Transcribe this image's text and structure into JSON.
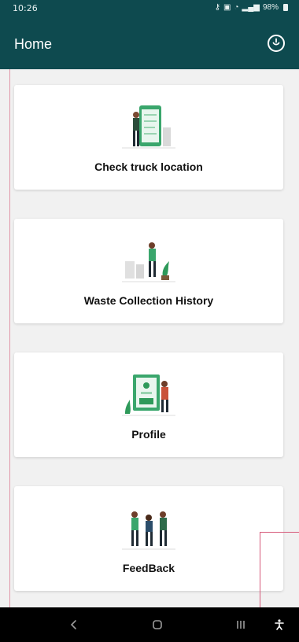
{
  "status_bar": {
    "time": "10:26",
    "battery": "98%"
  },
  "app_bar": {
    "title": "Home"
  },
  "cards": [
    {
      "label": "Check truck location",
      "icon": "phone-map-illustration-icon"
    },
    {
      "label": "Waste Collection History",
      "icon": "recycling-person-illustration-icon"
    },
    {
      "label": "Profile",
      "icon": "profile-card-illustration-icon"
    },
    {
      "label": "FeedBack",
      "icon": "group-people-illustration-icon"
    }
  ],
  "nav_bar": {
    "items": [
      "back-icon",
      "home-icon",
      "recents-icon",
      "accessibility-icon"
    ]
  },
  "colors": {
    "primary": "#0e4a4f",
    "background": "#f1f1f1",
    "card": "#ffffff",
    "accent_green": "#2e9a5a",
    "overlay_pink": "#d65a7a"
  }
}
